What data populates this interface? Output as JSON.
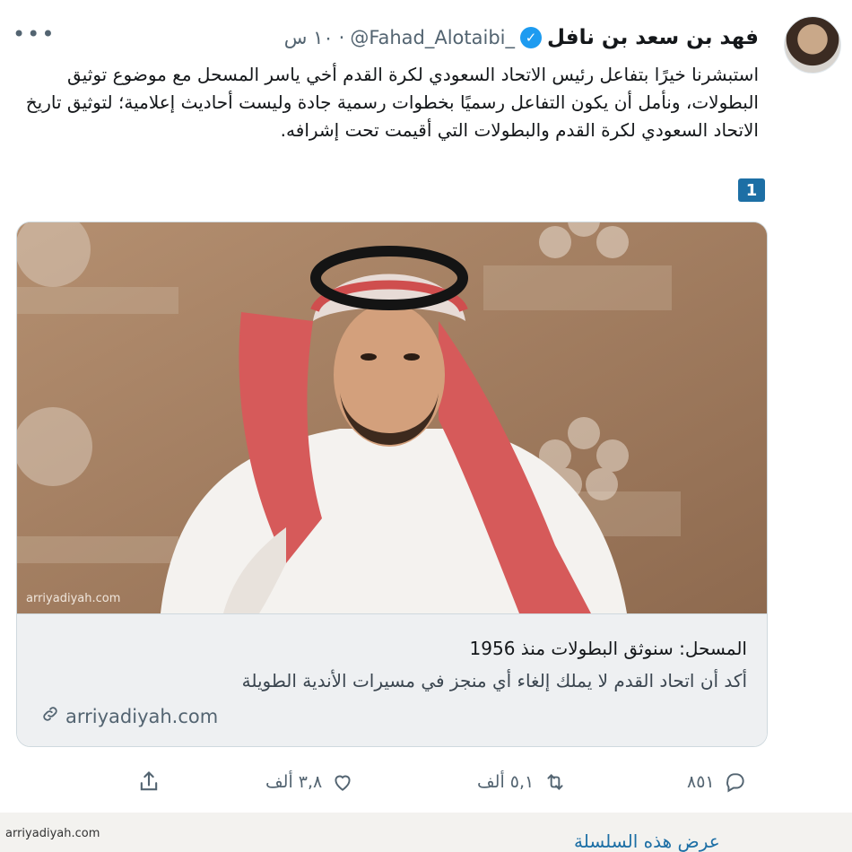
{
  "tweet": {
    "display_name": "فهد بن سعد بن نافل",
    "handle": "@Fahad_Alotaibi_",
    "time": "١٠ س",
    "separator": "·",
    "more_label": "•••",
    "text": "استبشرنا خيرًا بتفاعل رئيس الاتحاد السعودي لكرة القدم أخي ياسر المسحل مع موضوع توثيق البطولات، ونأمل أن يكون التفاعل رسميًا بخطوات رسمية جادة وليست أحاديث إعلامية؛ لتوثيق تاريخ الاتحاد السعودي لكرة القدم والبطولات التي أقيمت تحت إشرافه.",
    "thread_number": "1",
    "verified_icon": "check-badge"
  },
  "link_card": {
    "image_watermark": "arriyadiyah.com",
    "title": "المسحل: سنوثق البطولات منذ 1956",
    "description": "أكد أن اتحاد القدم لا يملك إلغاء أي منجز في مسيرات الأندية الطويلة",
    "domain": "arriyadiyah.com"
  },
  "actions": {
    "reply_count": "٨٥١",
    "retweet_count": "٥,١ ألف",
    "like_count": "٣,٨ ألف"
  },
  "footer": {
    "source": "arriyadiyah.com",
    "cut_text": "عرض هذه السلسلة"
  },
  "colors": {
    "accent": "#1d9bf0",
    "badge": "#1d6fa5",
    "muted": "#536471"
  }
}
